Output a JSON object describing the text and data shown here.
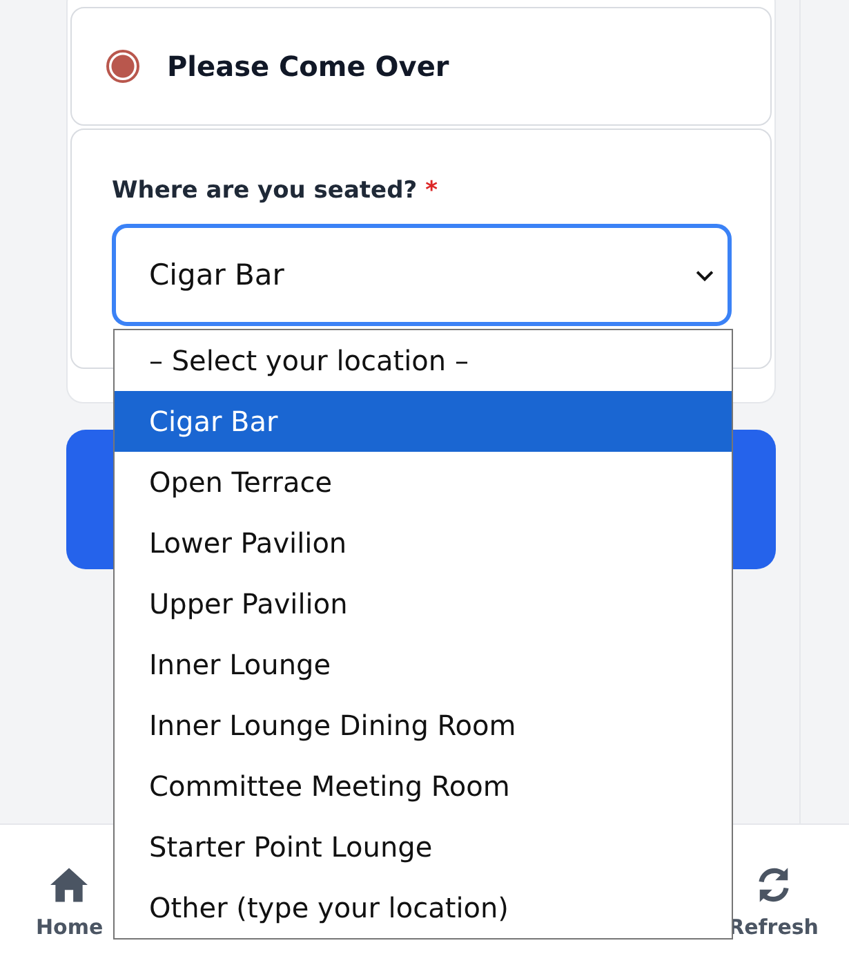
{
  "attendance": {
    "label": "Please Come Over",
    "selected": true
  },
  "seat_question": {
    "label": "Where are you seated?",
    "required_mark": "*",
    "value": "Cigar Bar",
    "expanded": true
  },
  "dropdown_options": [
    {
      "label": "– Select your location –",
      "selected": false
    },
    {
      "label": "Cigar Bar",
      "selected": true
    },
    {
      "label": "Open Terrace",
      "selected": false
    },
    {
      "label": "Lower Pavilion",
      "selected": false
    },
    {
      "label": "Upper Pavilion",
      "selected": false
    },
    {
      "label": "Inner Lounge",
      "selected": false
    },
    {
      "label": "Inner Lounge Dining Room",
      "selected": false
    },
    {
      "label": "Committee Meeting Room",
      "selected": false
    },
    {
      "label": "Starter Point Lounge",
      "selected": false
    },
    {
      "label": "Other (type your location)",
      "selected": false
    }
  ],
  "bottom_nav": [
    {
      "kind": "home",
      "label": "Home"
    },
    {
      "kind": "refresh",
      "label": "Refresh"
    }
  ]
}
